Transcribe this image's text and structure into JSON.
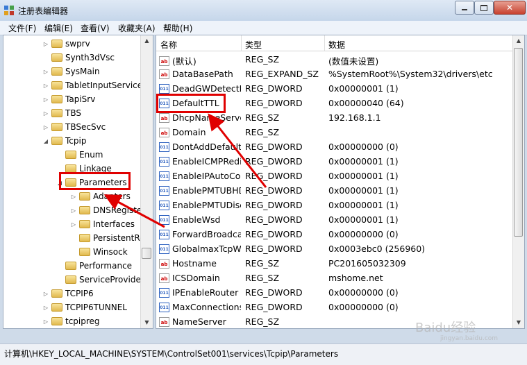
{
  "window": {
    "title": "注册表编辑器"
  },
  "menu": [
    "文件(F)",
    "编辑(E)",
    "查看(V)",
    "收藏夹(A)",
    "帮助(H)"
  ],
  "tree": [
    {
      "label": "swprv",
      "expander": "▷"
    },
    {
      "label": "Synth3dVsc",
      "expander": ""
    },
    {
      "label": "SysMain",
      "expander": "▷"
    },
    {
      "label": "TabletInputService",
      "expander": "▷"
    },
    {
      "label": "TapiSrv",
      "expander": "▷"
    },
    {
      "label": "TBS",
      "expander": "▷"
    },
    {
      "label": "TBSecSvc",
      "expander": "▷"
    },
    {
      "label": "Tcpip",
      "expander": "◢"
    },
    {
      "label": "Enum",
      "expander": ""
    },
    {
      "label": "Linkage",
      "expander": ""
    },
    {
      "label": "Parameters",
      "expander": "◢"
    },
    {
      "label": "Adapters",
      "expander": "▷"
    },
    {
      "label": "DNSRegisteredAdapters",
      "expander": "▷"
    },
    {
      "label": "Interfaces",
      "expander": "▷"
    },
    {
      "label": "PersistentRoutes",
      "expander": ""
    },
    {
      "label": "Winsock",
      "expander": ""
    },
    {
      "label": "Performance",
      "expander": ""
    },
    {
      "label": "ServiceProvider",
      "expander": ""
    },
    {
      "label": "TCPIP6",
      "expander": "▷"
    },
    {
      "label": "TCPIP6TUNNEL",
      "expander": "▷"
    },
    {
      "label": "tcpipreg",
      "expander": "▷"
    }
  ],
  "columns": {
    "name": "名称",
    "type": "类型",
    "data": "数据"
  },
  "values": [
    {
      "name": "(默认)",
      "type": "REG_SZ",
      "data": "(数值未设置)",
      "icon": "string-value-icon"
    },
    {
      "name": "DataBasePath",
      "type": "REG_EXPAND_SZ",
      "data": "%SystemRoot%\\System32\\drivers\\etc",
      "icon": "string-value-icon"
    },
    {
      "name": "DeadGWDetectDefault",
      "type": "REG_DWORD",
      "data": "0x00000001 (1)",
      "icon": "binary-value-icon"
    },
    {
      "name": "DefaultTTL",
      "type": "REG_DWORD",
      "data": "0x00000040 (64)",
      "icon": "binary-value-icon"
    },
    {
      "name": "DhcpNameServer",
      "type": "REG_SZ",
      "data": "192.168.1.1",
      "icon": "string-value-icon"
    },
    {
      "name": "Domain",
      "type": "REG_SZ",
      "data": "",
      "icon": "string-value-icon"
    },
    {
      "name": "DontAddDefaultGateway",
      "type": "REG_DWORD",
      "data": "0x00000000 (0)",
      "icon": "binary-value-icon"
    },
    {
      "name": "EnableICMPRedirect",
      "type": "REG_DWORD",
      "data": "0x00000001 (1)",
      "icon": "binary-value-icon"
    },
    {
      "name": "EnableIPAutoConfig",
      "type": "REG_DWORD",
      "data": "0x00000001 (1)",
      "icon": "binary-value-icon"
    },
    {
      "name": "EnablePMTUBHDetect",
      "type": "REG_DWORD",
      "data": "0x00000001 (1)",
      "icon": "binary-value-icon"
    },
    {
      "name": "EnablePMTUDiscovery",
      "type": "REG_DWORD",
      "data": "0x00000001 (1)",
      "icon": "binary-value-icon"
    },
    {
      "name": "EnableWsd",
      "type": "REG_DWORD",
      "data": "0x00000001 (1)",
      "icon": "binary-value-icon"
    },
    {
      "name": "ForwardBroadcasts",
      "type": "REG_DWORD",
      "data": "0x00000000 (0)",
      "icon": "binary-value-icon"
    },
    {
      "name": "GlobalmaxTcpWindowSize",
      "type": "REG_DWORD",
      "data": "0x0003ebc0 (256960)",
      "icon": "binary-value-icon"
    },
    {
      "name": "Hostname",
      "type": "REG_SZ",
      "data": "PC201605032309",
      "icon": "string-value-icon"
    },
    {
      "name": "ICSDomain",
      "type": "REG_SZ",
      "data": "mshome.net",
      "icon": "string-value-icon"
    },
    {
      "name": "IPEnableRouter",
      "type": "REG_DWORD",
      "data": "0x00000000 (0)",
      "icon": "binary-value-icon"
    },
    {
      "name": "MaxConnectionsPerServer",
      "type": "REG_DWORD",
      "data": "0x00000000 (0)",
      "icon": "binary-value-icon"
    },
    {
      "name": "NameServer",
      "type": "REG_SZ",
      "data": "",
      "icon": "string-value-icon"
    }
  ],
  "status": {
    "path": "计算机\\HKEY_LOCAL_MACHINE\\SYSTEM\\ControlSet001\\services\\Tcpip\\Parameters"
  },
  "watermark": {
    "text": "Baidu经验",
    "sub": "jingyan.baidu.com"
  },
  "colors": {
    "annotation": "#e00000",
    "folder": "#e1b94e"
  }
}
